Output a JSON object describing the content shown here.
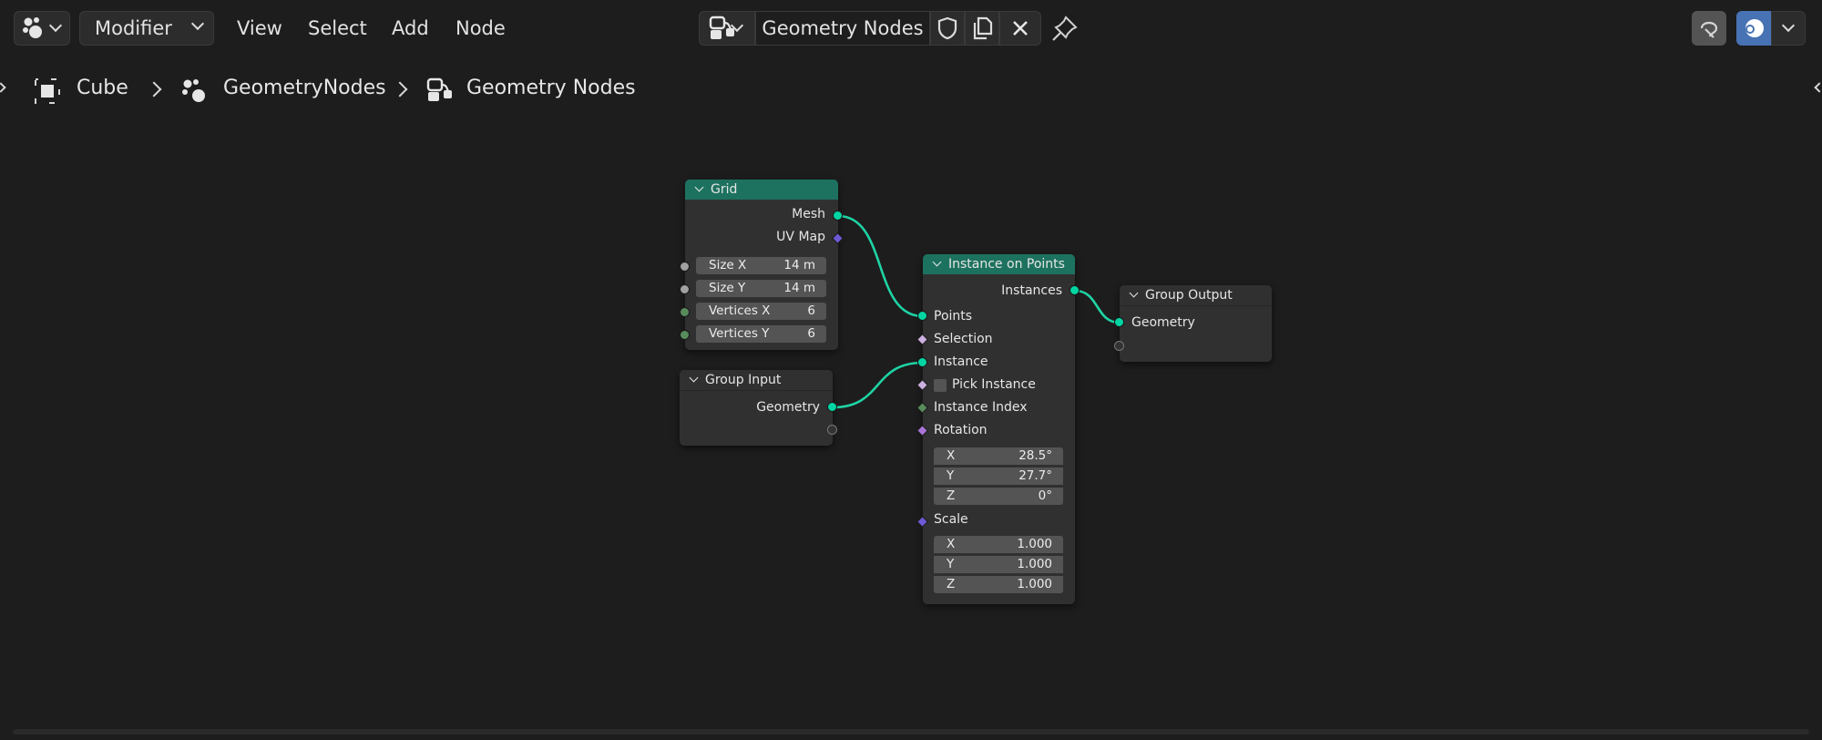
{
  "header": {
    "editor_type": {
      "icon": "geometry-nodes-editor-icon"
    },
    "mode_label": "Modifier",
    "menus": [
      "View",
      "Select",
      "Add",
      "Node"
    ],
    "node_tree": {
      "icon": "node-tree-icon",
      "name": "Geometry Nodes"
    },
    "right_icons": [
      "overlay-icon",
      "snapping-icon"
    ]
  },
  "breadcrumb": [
    "Cube",
    "GeometryNodes",
    "Geometry Nodes"
  ],
  "nodes": {
    "grid": {
      "title": "Grid",
      "outputs": [
        "Mesh",
        "UV Map"
      ],
      "fields": [
        {
          "name": "Size X",
          "value": "14 m"
        },
        {
          "name": "Size Y",
          "value": "14 m"
        },
        {
          "name": "Vertices X",
          "value": "6"
        },
        {
          "name": "Vertices Y",
          "value": "6"
        }
      ]
    },
    "group_input": {
      "title": "Group Input",
      "outputs": [
        "Geometry"
      ]
    },
    "instance_on_points": {
      "title": "Instance on Points",
      "output": "Instances",
      "inputs": [
        "Points",
        "Selection",
        "Instance",
        "Pick Instance",
        "Instance Index",
        "Rotation",
        "Scale"
      ],
      "rotation": [
        {
          "name": "X",
          "value": "28.5°"
        },
        {
          "name": "Y",
          "value": "27.7°"
        },
        {
          "name": "Z",
          "value": "0°"
        }
      ],
      "scale": [
        {
          "name": "X",
          "value": "1.000"
        },
        {
          "name": "Y",
          "value": "1.000"
        },
        {
          "name": "Z",
          "value": "1.000"
        }
      ]
    },
    "group_output": {
      "title": "Group Output",
      "inputs": [
        "Geometry"
      ]
    }
  },
  "colors": {
    "background": "#1d1d1d",
    "node_body": "#303030",
    "header_geometry": "#1d725f",
    "socket_geometry": "#00d6a3",
    "socket_vector": "#6c5ad6",
    "socket_float": "#a1a1a1",
    "socket_int": "#598c5c",
    "socket_bool": "#ccb0e0",
    "socket_rotation": "#a974d8",
    "link": "#1ed4a5"
  }
}
